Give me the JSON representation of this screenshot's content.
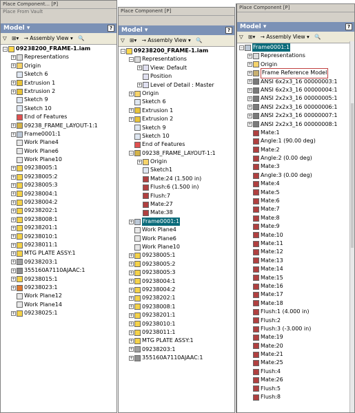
{
  "panel1": {
    "stub1": "Place Component...   [P]",
    "stub2": "Place From Vault",
    "header": "Model ▾",
    "help": "?",
    "toolbar": [
      "▽",
      "⊞▾",
      "→ Assembly View ▾",
      "🔍"
    ],
    "items": [
      {
        "d": 0,
        "e": "-",
        "i": "#ffd84a",
        "t": "09238200_FRAME-1.iam",
        "b": true
      },
      {
        "d": 1,
        "e": "+",
        "i": "#dcdcdc",
        "t": "Representations"
      },
      {
        "d": 1,
        "e": "+",
        "i": "#f6d36a",
        "t": "Origin"
      },
      {
        "d": 1,
        "e": "",
        "i": "#dfe7f2",
        "t": "Sketch 6"
      },
      {
        "d": 1,
        "e": "+",
        "i": "#e9c43a",
        "t": "Extrusion 1"
      },
      {
        "d": 1,
        "e": "+",
        "i": "#e9c43a",
        "t": "Extrusion 2"
      },
      {
        "d": 1,
        "e": "",
        "i": "#dfe7f2",
        "t": "Sketch 9"
      },
      {
        "d": 1,
        "e": "",
        "i": "#dfe7f2",
        "t": "Sketch 10"
      },
      {
        "d": 1,
        "e": "",
        "i": "#e05050",
        "t": "End of Features"
      },
      {
        "d": 1,
        "e": "+",
        "i": "#d4b44a",
        "t": "09238_FRAME_LAYOUT-1:1"
      },
      {
        "d": 1,
        "e": "+",
        "i": "#bcc8d6",
        "t": "Frame0001:1"
      },
      {
        "d": 1,
        "e": "",
        "i": "#e8e8e8",
        "t": "Work Plane4"
      },
      {
        "d": 1,
        "e": "",
        "i": "#e8e8e8",
        "t": "Work Plane6"
      },
      {
        "d": 1,
        "e": "",
        "i": "#e8e8e8",
        "t": "Work Plane10"
      },
      {
        "d": 1,
        "e": "+",
        "i": "#f4d24a",
        "t": "09238005:1"
      },
      {
        "d": 1,
        "e": "+",
        "i": "#f4d24a",
        "t": "09238005:2"
      },
      {
        "d": 1,
        "e": "+",
        "i": "#f4d24a",
        "t": "09238005:3"
      },
      {
        "d": 1,
        "e": "+",
        "i": "#f4d24a",
        "t": "09238004:1"
      },
      {
        "d": 1,
        "e": "+",
        "i": "#f4d24a",
        "t": "09238004:2"
      },
      {
        "d": 1,
        "e": "+",
        "i": "#f4d24a",
        "t": "09238202:1"
      },
      {
        "d": 1,
        "e": "+",
        "i": "#f4d24a",
        "t": "09238008:1"
      },
      {
        "d": 1,
        "e": "+",
        "i": "#f4d24a",
        "t": "09238201:1"
      },
      {
        "d": 1,
        "e": "+",
        "i": "#f4d24a",
        "t": "09238010:1"
      },
      {
        "d": 1,
        "e": "+",
        "i": "#f4d24a",
        "t": "09238011:1"
      },
      {
        "d": 1,
        "e": "+",
        "i": "#f4d24a",
        "t": "MTG PLATE ASSY:1"
      },
      {
        "d": 1,
        "e": "+",
        "i": "#a0a0a0",
        "t": "09238203:1"
      },
      {
        "d": 1,
        "e": "+",
        "i": "#909090",
        "t": "355160A7110AJAAC:1"
      },
      {
        "d": 1,
        "e": "+",
        "i": "#f4d24a",
        "t": "09238015:1"
      },
      {
        "d": 1,
        "e": "+",
        "i": "#e07a30",
        "t": "09238023:1"
      },
      {
        "d": 1,
        "e": "",
        "i": "#e8e8e8",
        "t": "Work Plane12"
      },
      {
        "d": 1,
        "e": "",
        "i": "#e8e8e8",
        "t": "Work Plane14"
      },
      {
        "d": 1,
        "e": "+",
        "i": "#f4d24a",
        "t": "09238025:1"
      }
    ]
  },
  "panel2": {
    "stub1": "Place Component   [P]",
    "header": "Model ▾",
    "help": "?",
    "toolbar": [
      "▽",
      "⊞▾",
      "→ Assembly View ▾",
      "🔍"
    ],
    "items": [
      {
        "d": 0,
        "e": "-",
        "i": "#ffd84a",
        "t": "09238200_FRAME-1.iam",
        "b": true
      },
      {
        "d": 1,
        "e": "-",
        "i": "#dcdcdc",
        "t": "Representations"
      },
      {
        "d": 2,
        "e": "+",
        "i": "#e0e0f0",
        "t": "View: Default"
      },
      {
        "d": 2,
        "e": "",
        "i": "#e0e0f0",
        "t": "Position"
      },
      {
        "d": 2,
        "e": "+",
        "i": "#e0e0f0",
        "t": "Level of Detail : Master"
      },
      {
        "d": 1,
        "e": "+",
        "i": "#f6d36a",
        "t": "Origin"
      },
      {
        "d": 1,
        "e": "",
        "i": "#dfe7f2",
        "t": "Sketch 6"
      },
      {
        "d": 1,
        "e": "+",
        "i": "#e9c43a",
        "t": "Extrusion 1"
      },
      {
        "d": 1,
        "e": "+",
        "i": "#e9c43a",
        "t": "Extrusion 2"
      },
      {
        "d": 1,
        "e": "",
        "i": "#dfe7f2",
        "t": "Sketch 9"
      },
      {
        "d": 1,
        "e": "",
        "i": "#dfe7f2",
        "t": "Sketch 10"
      },
      {
        "d": 1,
        "e": "",
        "i": "#e05050",
        "t": "End of Features"
      },
      {
        "d": 1,
        "e": "-",
        "i": "#d4b44a",
        "t": "09238_FRAME_LAYOUT-1:1"
      },
      {
        "d": 2,
        "e": "+",
        "i": "#f6d36a",
        "t": "Origin"
      },
      {
        "d": 2,
        "e": "",
        "i": "#dfe7f2",
        "t": "Sketch1"
      },
      {
        "d": 2,
        "e": "",
        "i": "#b04040",
        "t": "Mate:24 (1.500 in)"
      },
      {
        "d": 2,
        "e": "",
        "i": "#b04040",
        "t": "Flush:6 (1.500 in)"
      },
      {
        "d": 2,
        "e": "",
        "i": "#b04040",
        "t": "Flush:7"
      },
      {
        "d": 2,
        "e": "",
        "i": "#b04040",
        "t": "Mate:27"
      },
      {
        "d": 2,
        "e": "",
        "i": "#b04040",
        "t": "Mate:38"
      },
      {
        "d": 1,
        "e": "+",
        "i": "#bcc8d6",
        "t": "Frame0001:1",
        "s": true
      },
      {
        "d": 1,
        "e": "",
        "i": "#e8e8e8",
        "t": "Work Plane4"
      },
      {
        "d": 1,
        "e": "",
        "i": "#e8e8e8",
        "t": "Work Plane6"
      },
      {
        "d": 1,
        "e": "",
        "i": "#e8e8e8",
        "t": "Work Plane10"
      },
      {
        "d": 1,
        "e": "+",
        "i": "#f4d24a",
        "t": "09238005:1"
      },
      {
        "d": 1,
        "e": "+",
        "i": "#f4d24a",
        "t": "09238005:2"
      },
      {
        "d": 1,
        "e": "+",
        "i": "#f4d24a",
        "t": "09238005:3"
      },
      {
        "d": 1,
        "e": "+",
        "i": "#f4d24a",
        "t": "09238004:1"
      },
      {
        "d": 1,
        "e": "+",
        "i": "#f4d24a",
        "t": "09238004:2"
      },
      {
        "d": 1,
        "e": "+",
        "i": "#f4d24a",
        "t": "09238202:1"
      },
      {
        "d": 1,
        "e": "+",
        "i": "#f4d24a",
        "t": "09238008:1"
      },
      {
        "d": 1,
        "e": "+",
        "i": "#f4d24a",
        "t": "09238201:1"
      },
      {
        "d": 1,
        "e": "+",
        "i": "#f4d24a",
        "t": "09238010:1"
      },
      {
        "d": 1,
        "e": "+",
        "i": "#f4d24a",
        "t": "09238011:1"
      },
      {
        "d": 1,
        "e": "+",
        "i": "#f4d24a",
        "t": "MTG PLATE ASSY:1"
      },
      {
        "d": 1,
        "e": "+",
        "i": "#a0a0a0",
        "t": "09238203:1"
      },
      {
        "d": 1,
        "e": "+",
        "i": "#909090",
        "t": "355160A7110AJAAC:1"
      }
    ]
  },
  "panel3": {
    "stub1": "Place Component   [P]",
    "header": "Model ▾",
    "help": "?",
    "toolbar": [
      "▽",
      "⊞▾",
      "→ Assembly View ▾",
      "🔍"
    ],
    "items": [
      {
        "d": 0,
        "e": "-",
        "i": "#bcc8d6",
        "t": "Frame0001:1",
        "s": true
      },
      {
        "d": 1,
        "e": "+",
        "i": "#dcdcdc",
        "t": "Representations"
      },
      {
        "d": 1,
        "e": "+",
        "i": "#f6d36a",
        "t": "Origin"
      },
      {
        "d": 1,
        "e": "+",
        "i": "#c8b070",
        "t": "Frame Reference Model",
        "x": true
      },
      {
        "d": 1,
        "e": "+",
        "i": "#7a7a7a",
        "t": "ANSI 6x2x3_16 00000003:1"
      },
      {
        "d": 1,
        "e": "+",
        "i": "#7a7a7a",
        "t": "ANSI 6x2x3_16 00000004:1"
      },
      {
        "d": 1,
        "e": "+",
        "i": "#7a7a7a",
        "t": "ANSI 2x2x3_16 00000005:1"
      },
      {
        "d": 1,
        "e": "+",
        "i": "#7a7a7a",
        "t": "ANSI 2x2x3_16 00000006:1"
      },
      {
        "d": 1,
        "e": "+",
        "i": "#7a7a7a",
        "t": "ANSI 2x2x3_16 00000007:1"
      },
      {
        "d": 1,
        "e": "+",
        "i": "#7a7a7a",
        "t": "ANSI 2x2x3_16 00000008:1"
      },
      {
        "d": 1,
        "e": "",
        "i": "#b04040",
        "t": "Mate:1"
      },
      {
        "d": 1,
        "e": "",
        "i": "#b04040",
        "t": "Angle:1 (90.00 deg)"
      },
      {
        "d": 1,
        "e": "",
        "i": "#b04040",
        "t": "Mate:2"
      },
      {
        "d": 1,
        "e": "",
        "i": "#b04040",
        "t": "Angle:2 (0.00 deg)"
      },
      {
        "d": 1,
        "e": "",
        "i": "#b04040",
        "t": "Mate:3"
      },
      {
        "d": 1,
        "e": "",
        "i": "#b04040",
        "t": "Angle:3 (0.00 deg)"
      },
      {
        "d": 1,
        "e": "",
        "i": "#b04040",
        "t": "Mate:4"
      },
      {
        "d": 1,
        "e": "",
        "i": "#b04040",
        "t": "Mate:5"
      },
      {
        "d": 1,
        "e": "",
        "i": "#b04040",
        "t": "Mate:6"
      },
      {
        "d": 1,
        "e": "",
        "i": "#b04040",
        "t": "Mate:7"
      },
      {
        "d": 1,
        "e": "",
        "i": "#b04040",
        "t": "Mate:8"
      },
      {
        "d": 1,
        "e": "",
        "i": "#b04040",
        "t": "Mate:9"
      },
      {
        "d": 1,
        "e": "",
        "i": "#b04040",
        "t": "Mate:10"
      },
      {
        "d": 1,
        "e": "",
        "i": "#b04040",
        "t": "Mate:11"
      },
      {
        "d": 1,
        "e": "",
        "i": "#b04040",
        "t": "Mate:12"
      },
      {
        "d": 1,
        "e": "",
        "i": "#b04040",
        "t": "Mate:13"
      },
      {
        "d": 1,
        "e": "",
        "i": "#b04040",
        "t": "Mate:14"
      },
      {
        "d": 1,
        "e": "",
        "i": "#b04040",
        "t": "Mate:15"
      },
      {
        "d": 1,
        "e": "",
        "i": "#b04040",
        "t": "Mate:16"
      },
      {
        "d": 1,
        "e": "",
        "i": "#b04040",
        "t": "Mate:17"
      },
      {
        "d": 1,
        "e": "",
        "i": "#b04040",
        "t": "Mate:18"
      },
      {
        "d": 1,
        "e": "",
        "i": "#b04040",
        "t": "Flush:1 (4.000 in)"
      },
      {
        "d": 1,
        "e": "",
        "i": "#b04040",
        "t": "Flush:2"
      },
      {
        "d": 1,
        "e": "",
        "i": "#b04040",
        "t": "Flush:3 (-3.000 in)"
      },
      {
        "d": 1,
        "e": "",
        "i": "#b04040",
        "t": "Mate:19"
      },
      {
        "d": 1,
        "e": "",
        "i": "#b04040",
        "t": "Mate:20"
      },
      {
        "d": 1,
        "e": "",
        "i": "#b04040",
        "t": "Mate:21"
      },
      {
        "d": 1,
        "e": "",
        "i": "#b04040",
        "t": "Mate:25"
      },
      {
        "d": 1,
        "e": "",
        "i": "#b04040",
        "t": "Flush:4"
      },
      {
        "d": 1,
        "e": "",
        "i": "#b04040",
        "t": "Mate:26"
      },
      {
        "d": 1,
        "e": "",
        "i": "#b04040",
        "t": "Flush:5"
      },
      {
        "d": 1,
        "e": "",
        "i": "#b04040",
        "t": "Flush:8"
      }
    ]
  }
}
